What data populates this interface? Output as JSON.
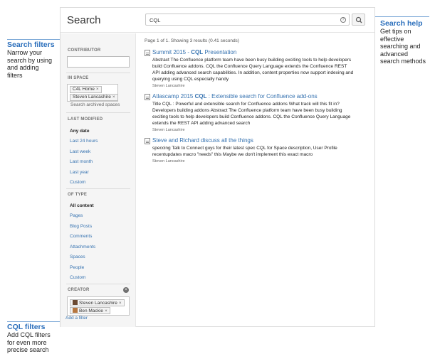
{
  "callouts": {
    "search_filters": {
      "title": "Search filters",
      "lines": [
        "Narrow your",
        "search by using",
        "and adding",
        "filters"
      ]
    },
    "search_help": {
      "title": "Search help",
      "lines": [
        "Get tips on",
        "effective",
        "searching and",
        "advanced",
        "search methods"
      ]
    },
    "cql_filters": {
      "title": "CQL filters",
      "lines": [
        "Add CQL filters",
        "for even more",
        "precise search"
      ]
    }
  },
  "header": {
    "title": "Search",
    "query": "CQL",
    "help_glyph": "?",
    "search_glyph": "⚲"
  },
  "sidebar": {
    "contributor": {
      "heading": "CONTRIBUTOR",
      "placeholder": ""
    },
    "in_space": {
      "heading": "IN SPACE",
      "tags": [
        "C4L Home",
        "Steven Lancashire"
      ],
      "archived_link": "Search archived spaces"
    },
    "last_modified": {
      "heading": "LAST MODIFIED",
      "options": [
        "Any date",
        "Last 24 hours",
        "Last week",
        "Last month",
        "Last year",
        "Custom"
      ],
      "selected": 0
    },
    "of_type": {
      "heading": "OF TYPE",
      "options": [
        "All content",
        "Pages",
        "Blog Posts",
        "Comments",
        "Attachments",
        "Spaces",
        "People",
        "Custom"
      ],
      "selected": 0
    },
    "creator": {
      "heading": "CREATOR",
      "tags": [
        "Steven Lancashire",
        "Ben Mackie"
      ]
    },
    "remove_glyph": "×",
    "add_filter": "Add a filter"
  },
  "results": {
    "summary": "Page 1 of 1. Showing 3 results (0.41 seconds)",
    "items": [
      {
        "title_pre": "Summit 2015 - ",
        "title_hl": "CQL",
        "title_post": " Presentation",
        "lines": [
          "Abstract The Confluence platform team have been busy building exciting tools to help developers",
          "build Confluence addons. CQL the Confluence Query Language extends the Confluence REST",
          "API adding advanced search capabilities. In addition, content properties now support indexing and",
          "querying using CQL especially handy"
        ],
        "author": "Steven Lancashire"
      },
      {
        "title_pre": "Atlascamp 2015 ",
        "title_hl": "CQL",
        "title_post": " : Extensible search for Confluence add-ons",
        "lines": [
          "Title CQL : Powerful and extensible search for Confluence addons What track will this fit in?",
          "Developers building addons Abstract The Confluence platform team have been busy building",
          "exciting tools to help developers build Confluence addons. CQL the Confluence Query Language",
          "extends the REST API adding advanced search"
        ],
        "author": "Steven Lancashire"
      },
      {
        "title_pre": "Steve and Richard discuss all the things",
        "title_hl": "",
        "title_post": "",
        "lines": [
          "speccing Talk to Connect guys for their latest spec CQL for Space description, User Profile",
          "recentupdates macro \"needs\" this Maybe we don't implement this exact macro"
        ],
        "author": "Steven Lancashire"
      }
    ]
  },
  "colors": {
    "accent": "#3572b0",
    "callout_title": "#2a6ebb",
    "sidebar_bg": "#f5f5f5"
  }
}
